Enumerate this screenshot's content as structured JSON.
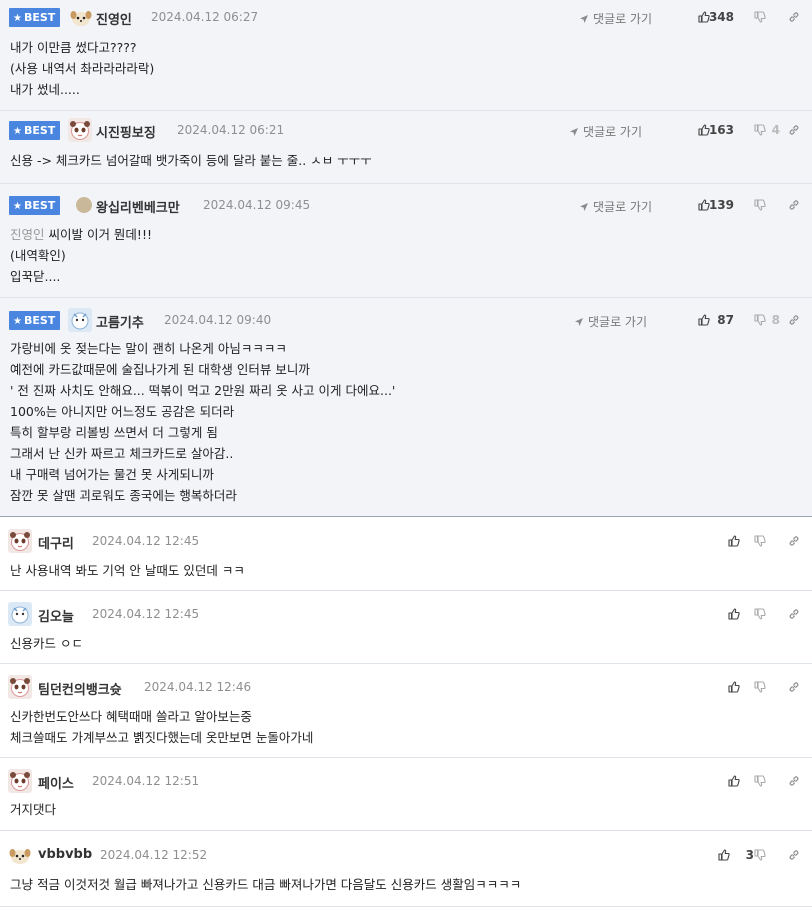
{
  "ui": {
    "best_label": "BEST",
    "goto_label": "댓글로 가기"
  },
  "comments": [
    {
      "best": true,
      "nick": "진영인",
      "date": "2024.04.12 06:27",
      "likes": "348",
      "dislikes": "",
      "avatar": "dog",
      "lines": [
        "내가 이만큼 썼다고????",
        "(사용 내역서 촤라라라라락)",
        "내가 썼네....."
      ]
    },
    {
      "best": true,
      "nick": "시진핑보징",
      "date": "2024.04.12 06:21",
      "likes": "163",
      "dislikes": "4",
      "avatar": "panda",
      "lines": [
        "신용 -> 체크카드 넘어갈때 뱃가죽이 등에 달라 붙는 줄.. ㅅㅂ ㅜㅜㅜ"
      ]
    },
    {
      "best": true,
      "nick": "왕십리벤베크만",
      "date": "2024.04.12 09:45",
      "likes": "139",
      "dislikes": "",
      "avatar": "dot",
      "mention": "진영인",
      "lines": [
        " 씨이발 이거 뭔데!!!",
        "(내역확인)",
        "입꾹닫...."
      ]
    },
    {
      "best": true,
      "nick": "고름기추",
      "date": "2024.04.12 09:40",
      "likes": "87",
      "dislikes": "8",
      "avatar": "blue",
      "lines": [
        "가랑비에 옷 젖는다는 말이 괜히 나온게 아님ㅋㅋㅋㅋ",
        "예전에 카드값때문에 술집나가게 된 대학생 인터뷰 보니까",
        "' 전 진짜 사치도 안해요... 떡볶이 먹고 2만원 짜리 옷 사고 이게 다에요...'",
        "100%는 아니지만 어느정도 공감은 되더라",
        "특히 할부랑 리볼빙 쓰면서 더 그렇게 됨",
        "그래서 난 신카 짜르고 체크카드로 살아감..",
        "내 구매력 넘어가는 물건 못 사게되니까",
        "잠깐 못 살땐 괴로워도 종국에는 행복하더라"
      ]
    },
    {
      "best": false,
      "nick": "데구리",
      "date": "2024.04.12 12:45",
      "likes": "",
      "dislikes": "",
      "avatar": "panda",
      "lines": [
        "난 사용내역 봐도 기억 안 날때도 있던데 ㅋㅋ"
      ]
    },
    {
      "best": false,
      "nick": "김오늘",
      "date": "2024.04.12 12:45",
      "likes": "",
      "dislikes": "",
      "avatar": "blue",
      "lines": [
        "신용카드 ㅇㄷ"
      ]
    },
    {
      "best": false,
      "nick": "팀던컨의뱅크슛",
      "date": "2024.04.12 12:46",
      "likes": "",
      "dislikes": "",
      "avatar": "panda",
      "lines": [
        "신카한번도안쓰다 혜택때매 쓸라고 알아보는중",
        "체크쓸때도 가계부쓰고 볡짓다했는데 옷만보면 눈돌아가네"
      ]
    },
    {
      "best": false,
      "nick": "페이스",
      "date": "2024.04.12 12:51",
      "likes": "",
      "dislikes": "",
      "avatar": "panda",
      "lines": [
        "거지댓다"
      ]
    },
    {
      "best": false,
      "nick": "vbbvbb",
      "date": "2024.04.12 12:52",
      "likes": "3",
      "dislikes": "",
      "avatar": "dog",
      "lines": [
        "그냥 적금 이것저것 월급 빠져나가고 신용카드 대금 빠져나가면 다음달도 신용카드 생활임ㅋㅋㅋㅋ"
      ]
    }
  ]
}
